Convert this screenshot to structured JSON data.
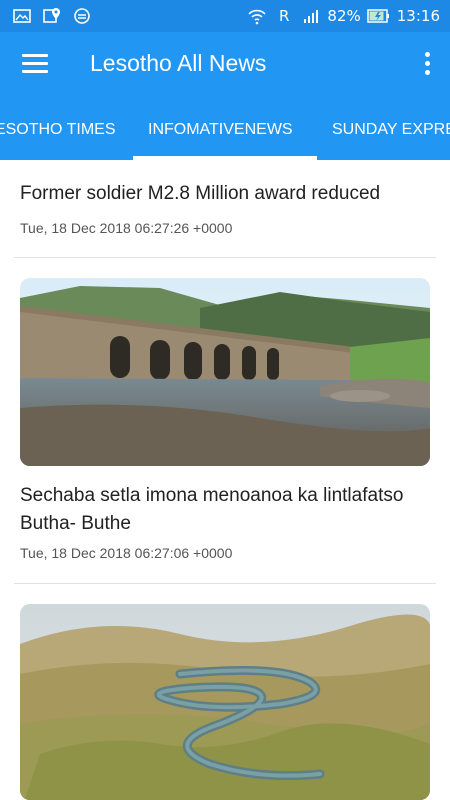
{
  "status_bar": {
    "carrier_indicator": "R",
    "battery": "82%",
    "time": "13:16",
    "icons": [
      "gallery-icon",
      "maps-icon",
      "sync-icon",
      "wifi-icon",
      "signal-icon",
      "battery-icon"
    ]
  },
  "app_bar": {
    "title": "Lesotho All News"
  },
  "tabs": [
    {
      "label": "LESOTHO TIMES",
      "selected": false
    },
    {
      "label": "INFOMATIVENEWS",
      "selected": true
    },
    {
      "label": "SUNDAY EXPRESS",
      "selected": false
    }
  ],
  "articles": [
    {
      "title": "Former soldier M2.8 Million award reduced",
      "date": "Tue, 18 Dec 2018 06:27:26 +0000"
    },
    {
      "title": "Sechaba setla imona menoanoa ka lintlafatso Butha- Buthe",
      "date": "Tue, 18 Dec 2018 06:27:06 +0000"
    }
  ],
  "colors": {
    "primary": "#2196f3",
    "primary_dark": "#1e88e5",
    "text_primary": "#212121",
    "text_secondary": "#555555"
  }
}
